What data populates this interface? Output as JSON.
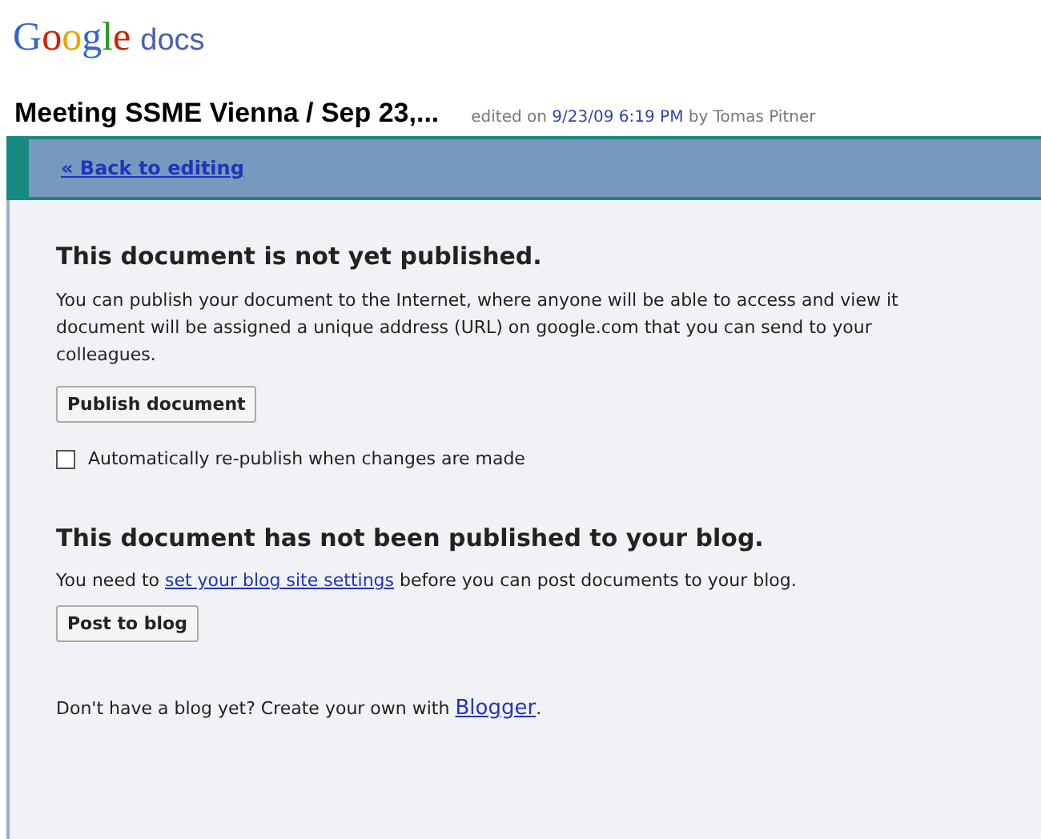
{
  "logo": {
    "brand": "Google",
    "product": "docs"
  },
  "document": {
    "title": "Meeting SSME Vienna / Sep 23,...",
    "edited_prefix": "edited on",
    "edited_date": "9/23/09 6:19 PM",
    "edited_by": "by Tomas Pitner"
  },
  "toolbar": {
    "back_link": "« Back to editing"
  },
  "publish": {
    "heading": "This document is not yet published.",
    "description_lines": [
      "You can publish your document to the Internet, where anyone will be able to access and view it",
      "document will be assigned a unique address (URL) on google.com that you can send to your",
      "colleagues."
    ],
    "button": "Publish document",
    "auto_republish": {
      "label": "Automatically re-publish when changes are made",
      "checked": false
    }
  },
  "blog": {
    "heading": "This document has not been published to your blog.",
    "note_before": "You need to",
    "settings_link": "set your blog site settings",
    "note_after": "before you can post documents to your blog.",
    "button": "Post to blog",
    "footer_before": "Don't have a blog yet? Create your own with",
    "footer_link": "Blogger",
    "footer_after": "."
  }
}
